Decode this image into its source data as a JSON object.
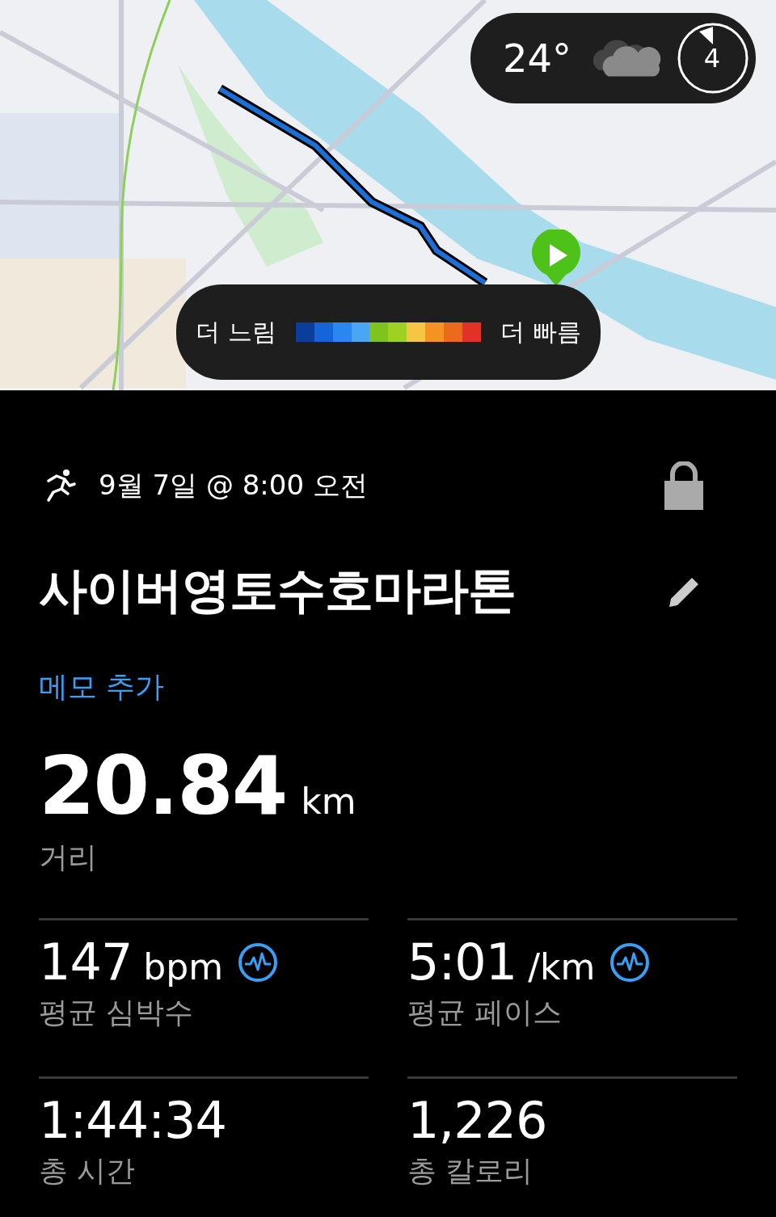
{
  "weather": {
    "temperature": "24°",
    "uv_index": "4"
  },
  "pace_legend": {
    "slow_label": "더 느림",
    "fast_label": "더 빠름",
    "segments": [
      {
        "color": "#0a3d9c"
      },
      {
        "color": "#1565d8"
      },
      {
        "color": "#2a86f0"
      },
      {
        "color": "#4aa6f5"
      },
      {
        "color": "#7dc41e"
      },
      {
        "color": "#9fd124"
      },
      {
        "color": "#f6c543"
      },
      {
        "color": "#f59224"
      },
      {
        "color": "#ec6a1c"
      },
      {
        "color": "#e03226"
      }
    ]
  },
  "activity": {
    "date": "9월 7일 @ 8:00 오전",
    "locked": true,
    "title": "사이버영토수호마라톤",
    "memo_link": "메모 추가"
  },
  "distance": {
    "value": "20.84",
    "unit": "km",
    "label": "거리"
  },
  "stats": [
    {
      "value": "147",
      "unit": "bpm",
      "label": "평균 심박수",
      "chart_icon": true
    },
    {
      "value": "5:01",
      "unit": "/km",
      "label": "평균 페이스",
      "chart_icon": true
    },
    {
      "value": "1:44:34",
      "label": "총 시간",
      "chart_icon": false
    },
    {
      "value": "1,226",
      "label": "총 칼로리",
      "chart_icon": false
    }
  ]
}
